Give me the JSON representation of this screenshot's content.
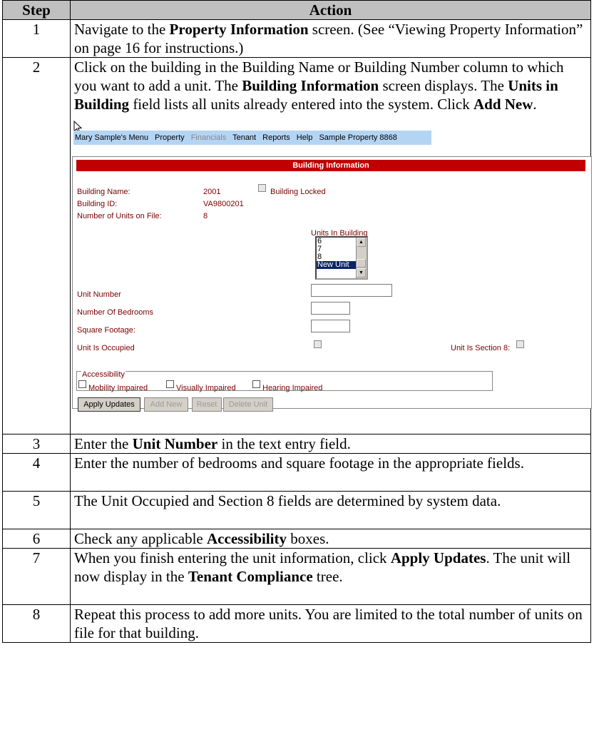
{
  "header": {
    "step": "Step",
    "action": "Action"
  },
  "steps": [
    {
      "num": "1",
      "parts": [
        {
          "t": "Navigate to the "
        },
        {
          "t": "Property Information",
          "b": true
        },
        {
          "t": " screen. (See “Viewing Property Information” on page 16 for instructions.)"
        }
      ]
    },
    {
      "num": "2",
      "parts": [
        {
          "t": "Click on the building in the Building Name or Building Number column to which you want to add a unit. The "
        },
        {
          "t": "Building Information",
          "b": true
        },
        {
          "t": " screen displays. The "
        },
        {
          "t": "Units in Building",
          "b": true
        },
        {
          "t": " field lists all units already entered into the system. Click "
        },
        {
          "t": "Add New",
          "b": true
        },
        {
          "t": "."
        }
      ]
    },
    {
      "num": "3",
      "parts": [
        {
          "t": "Enter the "
        },
        {
          "t": "Unit Number",
          "b": true
        },
        {
          "t": " in the text entry field."
        }
      ]
    },
    {
      "num": "4",
      "parts": [
        {
          "t": "Enter the number of bedrooms and square footage in the appropriate fields."
        }
      ]
    },
    {
      "num": "5",
      "parts": [
        {
          "t": "The Unit Occupied and Section 8 fields are determined by system data."
        }
      ]
    },
    {
      "num": "6",
      "parts": [
        {
          "t": "Check any applicable "
        },
        {
          "t": "Accessibility",
          "b": true
        },
        {
          "t": " boxes."
        }
      ]
    },
    {
      "num": "7",
      "parts": [
        {
          "t": "When you finish entering the unit information, click "
        },
        {
          "t": "Apply Updates",
          "b": true
        },
        {
          "t": ". The unit will now display in the "
        },
        {
          "t": "Tenant Compliance",
          "b": true
        },
        {
          "t": " tree."
        }
      ]
    },
    {
      "num": "8",
      "parts": [
        {
          "t": "Repeat this process to add more units.  You are limited to the total number of units on file for that building."
        }
      ]
    }
  ],
  "screenshot": {
    "menu": [
      "Mary Sample's Menu",
      "Property",
      "Financials",
      "Tenant",
      "Reports",
      "Help",
      "Sample Property 8868"
    ],
    "menu_disabled": "Financials",
    "panel_title": "Building Information",
    "building_name_label": "Building Name:",
    "building_name_value": "2001",
    "building_locked_label": "Building Locked",
    "building_id_label": "Building ID:",
    "building_id_value": "VA9800201",
    "units_on_file_label": "Number of Units on File:",
    "units_on_file_value": "8",
    "units_in_building_label": "Units In Building",
    "units_list": [
      "6",
      "7",
      "8",
      "New Unit"
    ],
    "units_list_selected": "New Unit",
    "unit_number_label": "Unit Number",
    "bedrooms_label": "Number Of Bedrooms",
    "square_footage_label": "Square Footage:",
    "unit_occupied_label": "Unit Is Occupied",
    "unit_section8_label": "Unit Is Section 8:",
    "accessibility_legend": "Accessibility",
    "accessibility_options": [
      "Mobility Impaired",
      "Visually Impaired",
      "Hearing Impaired"
    ],
    "buttons": {
      "apply": "Apply Updates",
      "add_new": "Add New",
      "reset": "Reset",
      "delete": "Delete Unit"
    }
  }
}
